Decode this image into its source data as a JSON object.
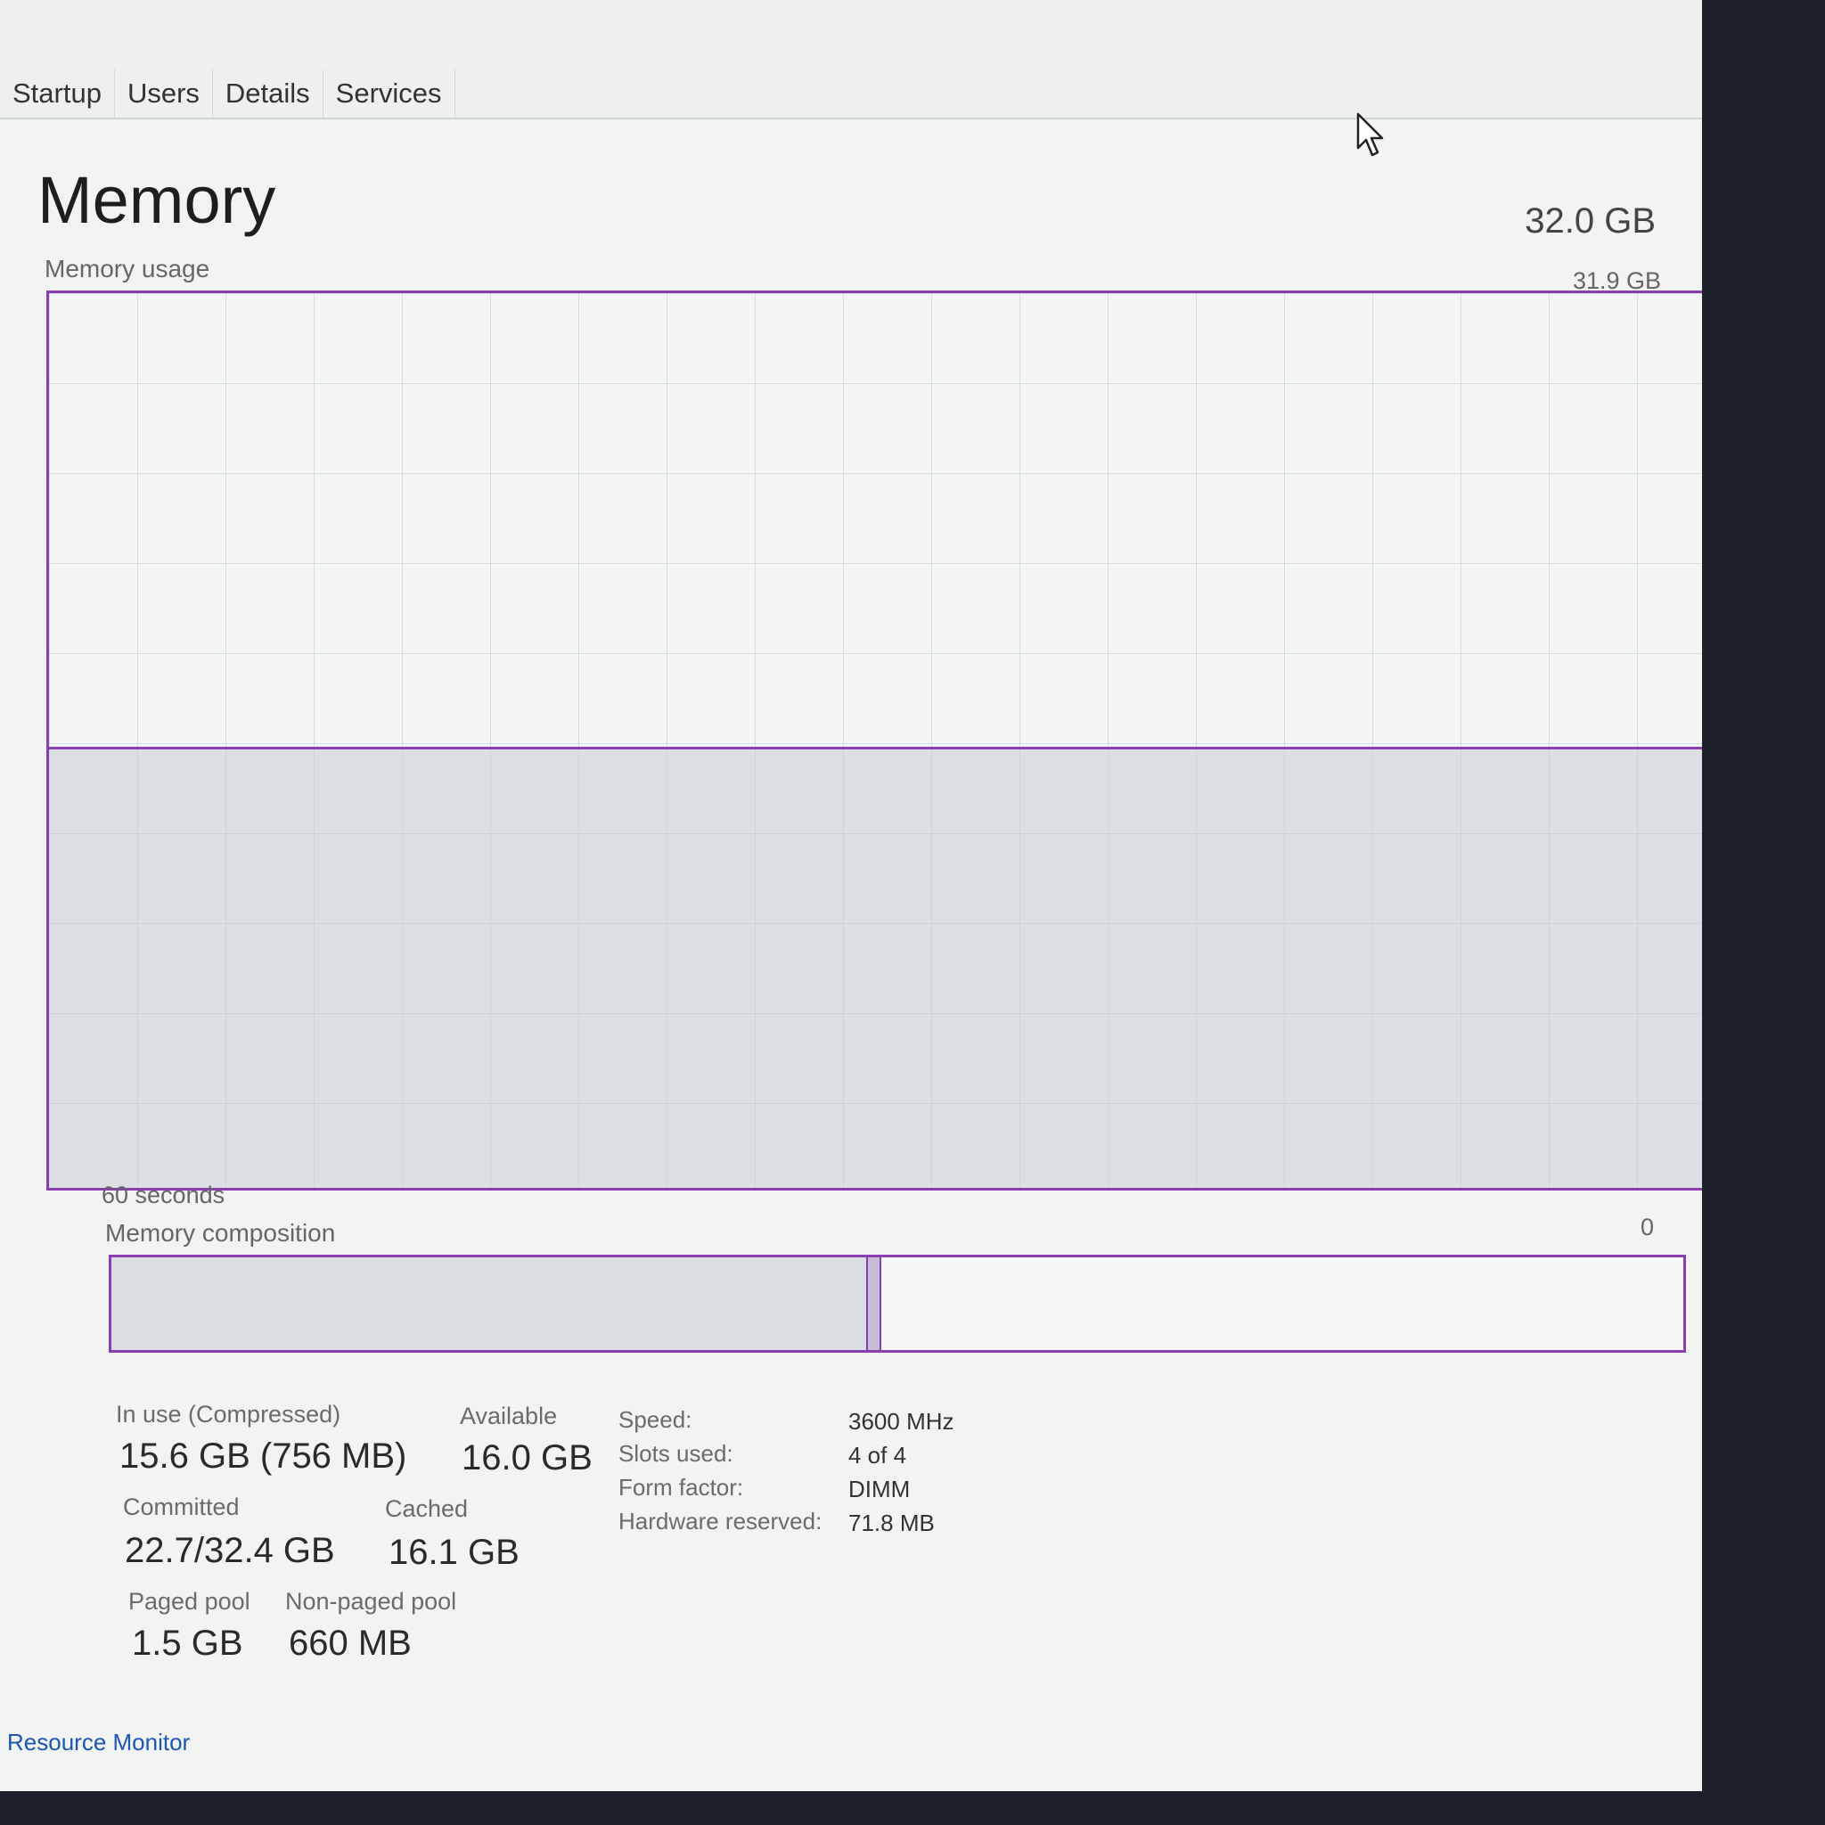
{
  "tabs": [
    "Startup",
    "Users",
    "Details",
    "Services"
  ],
  "header": {
    "title": "Memory",
    "total": "32.0 GB"
  },
  "graph": {
    "label": "Memory usage",
    "max_label": "31.9 GB",
    "time_label": "60 seconds",
    "min_label": "0",
    "usage_fraction": 0.49
  },
  "composition": {
    "label": "Memory composition",
    "in_use_fraction": 0.48,
    "modified_fraction": 0.01
  },
  "stats": {
    "in_use": {
      "label": "In use (Compressed)",
      "value": "15.6 GB (756 MB)"
    },
    "available": {
      "label": "Available",
      "value": "16.0 GB"
    },
    "committed": {
      "label": "Committed",
      "value": "22.7/32.4 GB"
    },
    "cached": {
      "label": "Cached",
      "value": "16.1 GB"
    },
    "paged_pool": {
      "label": "Paged pool",
      "value": "1.5 GB"
    },
    "non_paged_pool": {
      "label": "Non-paged pool",
      "value": "660 MB"
    }
  },
  "details": [
    {
      "label": "Speed:",
      "value": "3600 MHz"
    },
    {
      "label": "Slots used:",
      "value": "4 of 4"
    },
    {
      "label": "Form factor:",
      "value": "DIMM"
    },
    {
      "label": "Hardware reserved:",
      "value": "71.8 MB"
    }
  ],
  "footer": {
    "resource_monitor": "Resource Monitor"
  },
  "colors": {
    "accent": "#8a3fb0",
    "link": "#1a56b3"
  }
}
